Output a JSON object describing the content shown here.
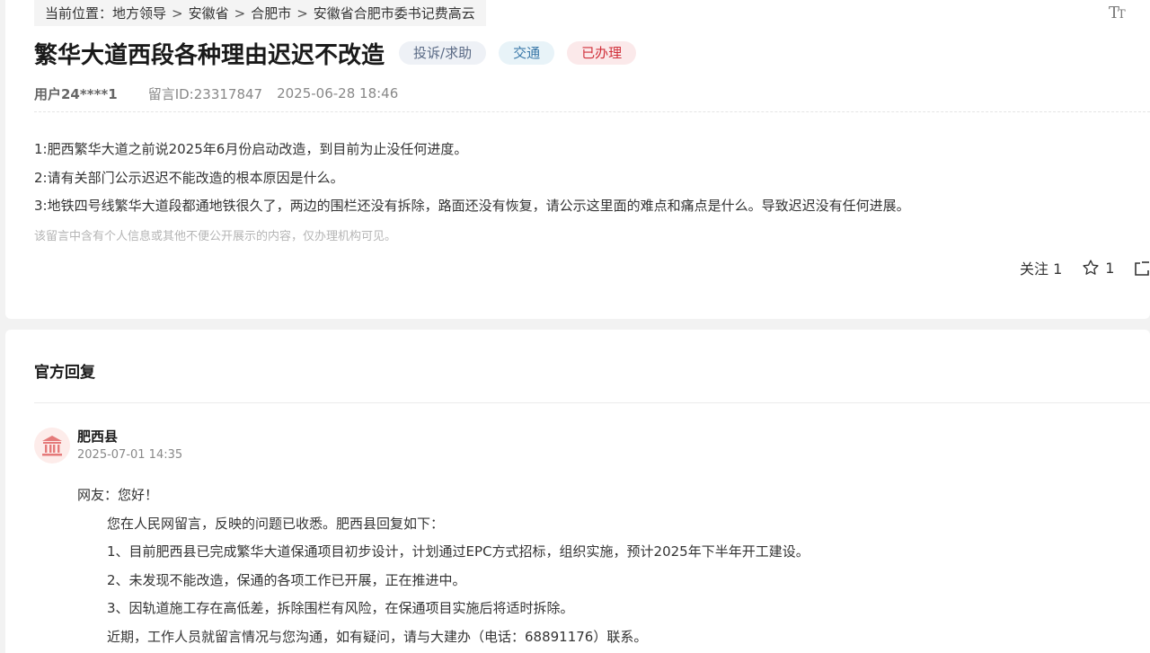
{
  "breadcrumb": {
    "prefix": "当前位置：",
    "items": [
      "地方领导",
      "安徽省",
      "合肥市",
      "安徽省合肥市委书记费高云"
    ],
    "separator": ">"
  },
  "font_toggle": {
    "large": "T",
    "small": "T"
  },
  "post": {
    "title": "繁华大道西段各种理由迟迟不改造",
    "tags": {
      "type": "投诉/求助",
      "field": "交通",
      "status": "已办理"
    },
    "user": "用户24****1",
    "message_id": "留言ID:23317847",
    "time": "2025-06-28 18:46",
    "content": [
      "1:肥西繁华大道之前说2025年6月份启动改造，到目前为止没任何进度。",
      "2:请有关部门公示迟迟不能改造的根本原因是什么。",
      "3:地铁四号线繁华大道段都通地铁很久了，两边的围栏还没有拆除，路面还没有恢复，请公示这里面的难点和痛点是什么。导致迟迟没有任何进展。"
    ],
    "privacy_notice": "该留言中含有个人信息或其他不便公开展示的内容，仅办理机构可见。",
    "actions": {
      "follow_label": "关注",
      "follow_count": "1",
      "star_count": "1"
    }
  },
  "reply": {
    "heading": "官方回复",
    "org": "肥西县",
    "time": "2025-07-01 14:35",
    "greeting": "网友：您好！",
    "paragraphs": [
      "您在人民网留言，反映的问题已收悉。肥西县回复如下：",
      "1、目前肥西县已完成繁华大道保通项目初步设计，计划通过EPC方式招标，组织实施，预计2025年下半年开工建设。",
      "2、未发现不能改造，保通的各项工作已开展，正在推进中。",
      "3、因轨道施工存在高低差，拆除围栏有风险，在保通项目实施后将适时拆除。",
      "近期，工作人员就留言情况与您沟通，如有疑问，请与大建办（电话：68891176）联系。"
    ]
  },
  "colors": {
    "status_red": "#d0303a",
    "field_blue": "#3a78a8",
    "avatar_bg": "#fdecea",
    "avatar_icon": "#e57a7a"
  },
  "icons": {
    "font_size": "font-size-icon",
    "star": "star-icon",
    "share": "share-icon",
    "org_avatar": "government-building-icon"
  }
}
